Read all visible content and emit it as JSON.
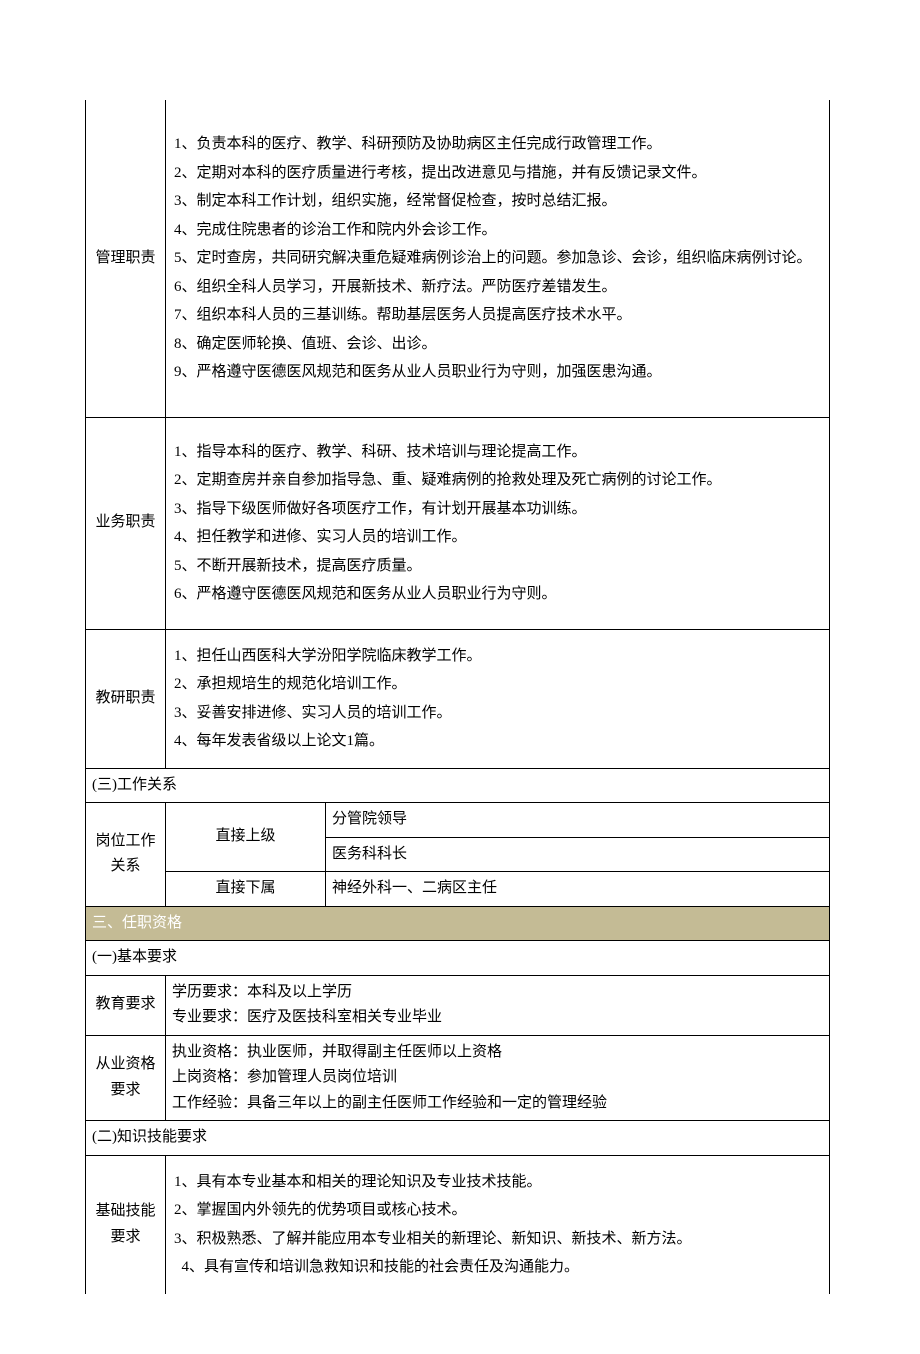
{
  "rows": {
    "mgmt": {
      "label": "管理职责",
      "items": [
        "1、负责本科的医疗、教学、科研预防及协助病区主任完成行政管理工作。",
        "2、定期对本科的医疗质量进行考核，提出改进意见与措施，并有反馈记录文件。",
        "3、制定本科工作计划，组织实施，经常督促检查，按时总结汇报。",
        "4、完成住院患者的诊治工作和院内外会诊工作。",
        "5、定时查房，共同研究解决重危疑难病例诊治上的问题。参加急诊、会诊，组织临床病例讨论。",
        "6、组织全科人员学习，开展新技术、新疗法。严防医疗差错发生。",
        "7、组织本科人员的三基训练。帮助基层医务人员提高医疗技术水平。",
        "8、确定医师轮换、值班、会诊、出诊。",
        "9、严格遵守医德医风规范和医务从业人员职业行为守则，加强医患沟通。"
      ]
    },
    "biz": {
      "label": "业务职责",
      "items": [
        "1、指导本科的医疗、教学、科研、技术培训与理论提高工作。",
        "2、定期查房并亲自参加指导急、重、疑难病例的抢救处理及死亡病例的讨论工作。",
        "3、指导下级医师做好各项医疗工作，有计划开展基本功训练。",
        "4、担任教学和进修、实习人员的培训工作。",
        "5、不断开展新技术，提高医疗质量。",
        "6、严格遵守医德医风规范和医务从业人员职业行为守则。"
      ]
    },
    "teach": {
      "label": "教研职责",
      "items": [
        "1、担任山西医科大学汾阳学院临床教学工作。",
        "2、承担规培生的规范化培训工作。",
        "3、妥善安排进修、实习人员的培训工作。",
        "4、每年发表省级以上论文1篇。"
      ]
    }
  },
  "work_rel": {
    "header": "(三)工作关系",
    "label": "岗位工作关系",
    "sup_label": "直接上级",
    "sup_vals": [
      "分管院领导",
      "医务科科长"
    ],
    "sub_label": "直接下属",
    "sub_val": "神经外科一、二病区主任"
  },
  "section3": {
    "header": "三、任职资格"
  },
  "basic": {
    "header": "(一)基本要求",
    "edu": {
      "label": "教育要求",
      "lines": [
        "学历要求：本科及以上学历",
        "专业要求：医疗及医技科室相关专业毕业"
      ]
    },
    "qual": {
      "label": "从业资格要求",
      "lines": [
        "执业资格：执业医师，并取得副主任医师以上资格",
        "上岗资格：参加管理人员岗位培训",
        "工作经验：具备三年以上的副主任医师工作经验和一定的管理经验"
      ]
    }
  },
  "skill": {
    "header": "(二)知识技能要求",
    "base": {
      "label": "基础技能要求",
      "items": [
        "1、具有本专业基本和相关的理论知识及专业技术技能。",
        "2、掌握国内外领先的优势项目或核心技术。",
        "3、积极熟悉、了解并能应用本专业相关的新理论、新知识、新技术、新方法。",
        "4、具有宣传和培训急救知识和技能的社会责任及沟通能力。"
      ]
    }
  }
}
